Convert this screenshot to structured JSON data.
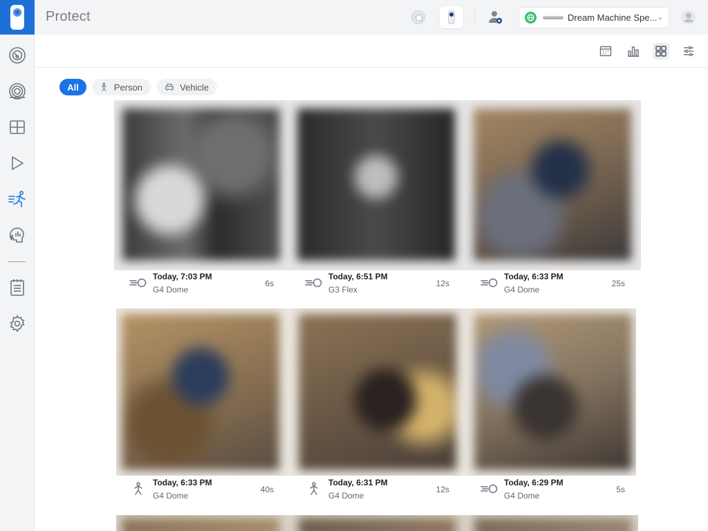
{
  "app": {
    "title": "Protect"
  },
  "header": {
    "console": {
      "name": "Dream Machine Spe...",
      "status_color": "#38c172"
    },
    "icons": [
      "dome-camera-icon",
      "g4-camera-icon",
      "admin-settings-icon",
      "user-avatar-icon"
    ]
  },
  "sidebar": {
    "items": [
      {
        "name": "dashboard",
        "icon": "speedometer-icon",
        "active": false
      },
      {
        "name": "devices",
        "icon": "camera-lens-icon",
        "active": false
      },
      {
        "name": "liveview",
        "icon": "grid-icon",
        "active": false
      },
      {
        "name": "timelapse",
        "icon": "play-icon",
        "active": false
      },
      {
        "name": "detections",
        "icon": "running-person-icon",
        "active": true
      },
      {
        "name": "smart",
        "icon": "head-icon",
        "active": false
      },
      {
        "name": "logs",
        "icon": "notepad-icon",
        "active": false
      },
      {
        "name": "settings",
        "icon": "gear-icon",
        "active": false
      }
    ],
    "active_color": "#1a73e8"
  },
  "toolbar": {
    "tools": [
      "calendar-icon",
      "bar-chart-icon",
      "grid-view-icon",
      "filter-sliders-icon"
    ],
    "active_tool": "grid-view-icon"
  },
  "filters": {
    "all": "All",
    "person": "Person",
    "vehicle": "Vehicle",
    "active": "all"
  },
  "events": [
    {
      "time": "Today, 7:03 PM",
      "camera": "G4 Dome",
      "duration": "6s",
      "type": "motion"
    },
    {
      "time": "Today, 6:51 PM",
      "camera": "G3 Flex",
      "duration": "12s",
      "type": "motion"
    },
    {
      "time": "Today, 6:33 PM",
      "camera": "G4 Dome",
      "duration": "25s",
      "type": "motion"
    },
    {
      "time": "Today, 6:33 PM",
      "camera": "G4 Dome",
      "duration": "40s",
      "type": "person"
    },
    {
      "time": "Today, 6:31 PM",
      "camera": "G4 Dome",
      "duration": "12s",
      "type": "person"
    },
    {
      "time": "Today, 6:29 PM",
      "camera": "G4 Dome",
      "duration": "5s",
      "type": "motion"
    }
  ]
}
